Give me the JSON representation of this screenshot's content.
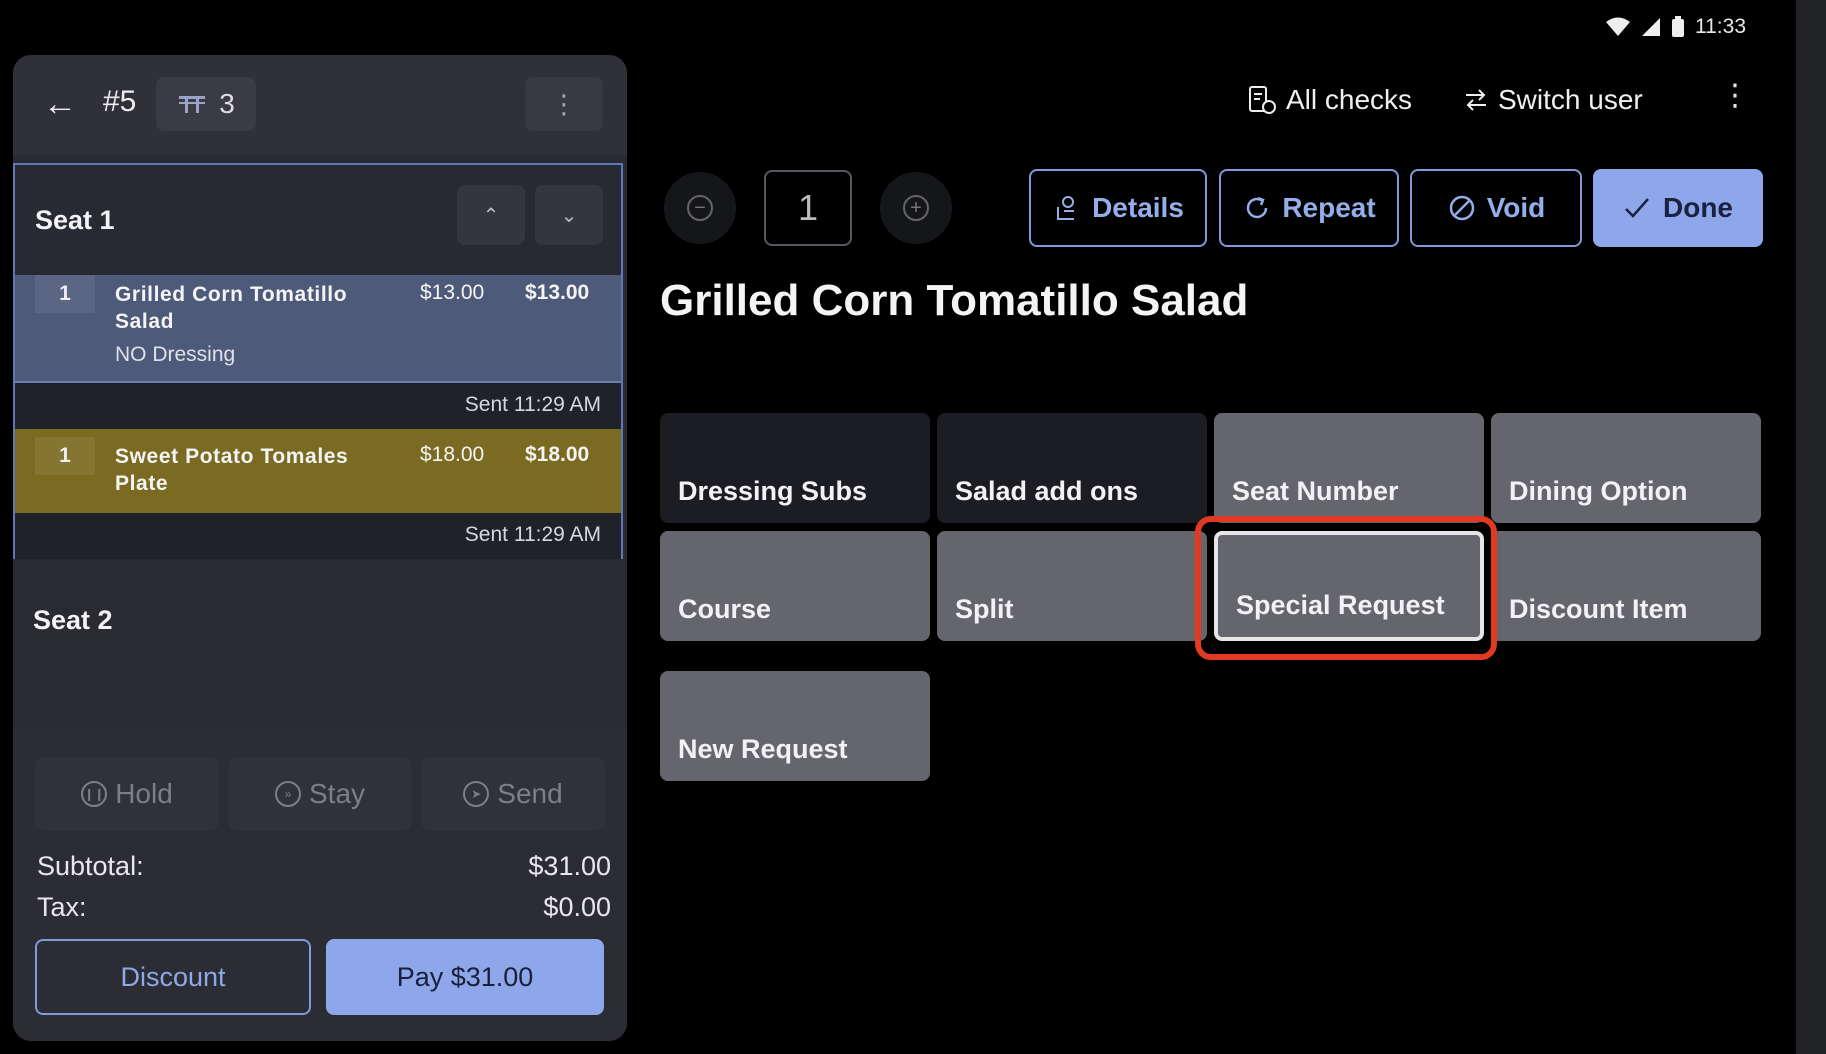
{
  "status_bar": {
    "time": "11:33"
  },
  "check": {
    "back_icon": "back-arrow-icon",
    "number": "#5",
    "table_icon": "table-icon",
    "table_count": "3"
  },
  "seats": [
    {
      "label": "Seat 1",
      "items": [
        {
          "qty": "1",
          "name": "Grilled Corn Tomatillo Salad",
          "modifier": "NO Dressing",
          "unit_price": "$13.00",
          "total": "$13.00",
          "sent": "Sent 11:29 AM"
        },
        {
          "qty": "1",
          "name": "Sweet Potato Tomales Plate",
          "unit_price": "$18.00",
          "total": "$18.00",
          "sent": "Sent 11:29 AM"
        }
      ]
    },
    {
      "label": "Seat 2"
    }
  ],
  "actions": {
    "hold": "Hold",
    "stay": "Stay",
    "send": "Send"
  },
  "totals": {
    "subtotal_label": "Subtotal:",
    "subtotal": "$31.00",
    "tax_label": "Tax:",
    "tax": "$0.00"
  },
  "footer": {
    "discount": "Discount",
    "pay": "Pay $31.00"
  },
  "top_bar": {
    "all_checks": "All checks",
    "switch_user": "Switch user"
  },
  "item_editor": {
    "quantity": "1",
    "details": "Details",
    "repeat": "Repeat",
    "void": "Void",
    "done": "Done",
    "title": "Grilled Corn Tomatillo Salad"
  },
  "modifier_tiles": [
    "Dressing Subs",
    "Salad add ons",
    "Seat Number",
    "Dining Option",
    "Course",
    "Split",
    "Special Request",
    "Discount Item",
    "New Request"
  ],
  "colors": {
    "accent": "#8da7ea",
    "item_selected": "#4d5a79",
    "item_highlight": "#7b6a22",
    "highlight_box": "#e13a22"
  }
}
